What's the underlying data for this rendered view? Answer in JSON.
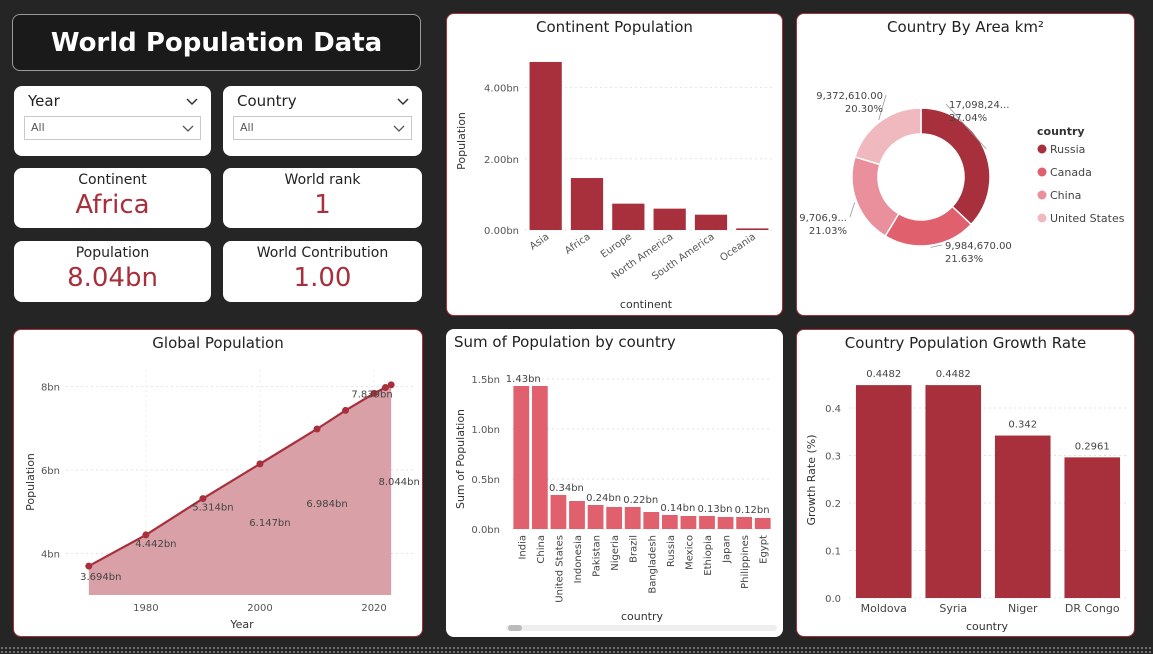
{
  "header": {
    "title": "World Population Data"
  },
  "slicers": {
    "year": {
      "label": "Year",
      "value": "All"
    },
    "country": {
      "label": "Country",
      "value": "All"
    }
  },
  "kpis": {
    "continent": {
      "label": "Continent",
      "value": "Africa"
    },
    "world_rank": {
      "label": "World rank",
      "value": "1"
    },
    "population": {
      "label": "Population",
      "value": "8.04bn"
    },
    "world_contribution": {
      "label": "World Contribution",
      "value": "1.00"
    }
  },
  "colors": {
    "accent": "#a8303c",
    "pink": "#e0606e",
    "area": "#d9a0a7",
    "light1": "#e9909c",
    "light2": "#f0b8bf"
  },
  "chart_data": [
    {
      "id": "continent_population",
      "type": "bar",
      "title": "Continent Population",
      "xlabel": "continent",
      "ylabel": "Population",
      "categories": [
        "Asia",
        "Africa",
        "Europe",
        "North America",
        "South America",
        "Oceania"
      ],
      "values": [
        4.72,
        1.46,
        0.74,
        0.6,
        0.43,
        0.045
      ],
      "yticks": [
        "0.00bn",
        "2.00bn",
        "4.00bn"
      ],
      "ylim": [
        0,
        5.0
      ]
    },
    {
      "id": "country_by_area",
      "type": "pie",
      "title": "Country By Area km²",
      "legend_title": "country",
      "categories": [
        "Russia",
        "Canada",
        "China",
        "United States"
      ],
      "values": [
        37.04,
        21.63,
        21.03,
        20.3
      ],
      "labels": [
        [
          "17,098,24...",
          "37.04%"
        ],
        [
          "9,984,670.00",
          "21.63%"
        ],
        [
          "9,706,9...",
          "21.03%"
        ],
        [
          "9,372,610.00",
          "20.30%"
        ]
      ],
      "colors": [
        "#a8303c",
        "#e0606e",
        "#e9909c",
        "#f0b8bf"
      ]
    },
    {
      "id": "global_population",
      "type": "area",
      "title": "Global Population",
      "xlabel": "Year",
      "ylabel": "Population",
      "x": [
        1970,
        1980,
        1990,
        2000,
        2010,
        2015,
        2020,
        2022,
        2023
      ],
      "values": [
        3.694,
        4.442,
        5.314,
        6.147,
        6.984,
        7.43,
        7.839,
        7.98,
        8.044
      ],
      "point_labels": [
        "3.694bn",
        "4.442bn",
        "5.314bn",
        "6.147bn",
        "6.984bn",
        "",
        "7.839bn",
        "",
        "8.044bn"
      ],
      "xticks": [
        "1980",
        "2000",
        "2020"
      ],
      "yticks": [
        "4bn",
        "6bn",
        "8bn"
      ],
      "ylim": [
        3.0,
        8.4
      ],
      "xlim": [
        1966,
        2027
      ]
    },
    {
      "id": "population_by_country",
      "type": "bar",
      "title": "Sum of Population by country",
      "xlabel": "country",
      "ylabel": "Sum of Population",
      "categories": [
        "India",
        "China",
        "United States",
        "Indonesia",
        "Pakistan",
        "Nigeria",
        "Brazil",
        "Bangladesh",
        "Russia",
        "Mexico",
        "Ethiopia",
        "Japan",
        "Philippines",
        "Egypt"
      ],
      "values": [
        1.43,
        1.43,
        0.34,
        0.28,
        0.24,
        0.22,
        0.22,
        0.17,
        0.14,
        0.13,
        0.13,
        0.12,
        0.12,
        0.11
      ],
      "value_labels": [
        "1.43bn",
        "",
        "0.34bn",
        "",
        "0.24bn",
        "",
        "0.22bn",
        "",
        "0.14bn",
        "",
        "0.13bn",
        "",
        "0.12bn",
        ""
      ],
      "yticks": [
        "0.0bn",
        "0.5bn",
        "1.0bn",
        "1.5bn"
      ],
      "ylim": [
        0,
        1.6
      ]
    },
    {
      "id": "growth_rate",
      "type": "bar",
      "title": "Country Population Growth Rate",
      "xlabel": "country",
      "ylabel": "Growth Rate (%)",
      "categories": [
        "Moldova",
        "Syria",
        "Niger",
        "DR Congo"
      ],
      "values": [
        0.4482,
        0.4482,
        0.342,
        0.2961
      ],
      "value_labels": [
        "0.4482",
        "0.4482",
        "0.342",
        "0.2961"
      ],
      "yticks": [
        "0.0",
        "0.1",
        "0.2",
        "0.3",
        "0.4"
      ],
      "ylim": [
        0,
        0.48
      ]
    }
  ]
}
